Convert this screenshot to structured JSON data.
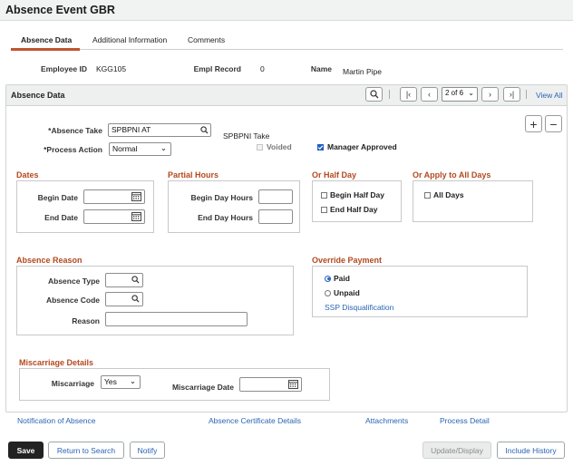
{
  "page_title": "Absence Event GBR",
  "tabs": [
    {
      "label": "Absence Data",
      "active": true
    },
    {
      "label": "Additional Information"
    },
    {
      "label": "Comments"
    }
  ],
  "employee": {
    "id_label": "Employee ID",
    "id_value": "KGG105",
    "rec_label": "Empl Record",
    "rec_value": "0",
    "name_label": "Name",
    "name_value": "Martin Pipe"
  },
  "panel": {
    "title": "Absence Data",
    "page_selector": "2 of 6",
    "view_all": "View All"
  },
  "absence": {
    "take_label": "*Absence Take",
    "take_value": "SPBPNI AT",
    "take_desc": "SPBPNI Take",
    "action_label": "*Process Action",
    "action_value": "Normal",
    "voided_label": "Voided",
    "voided_checked": false,
    "approved_label": "Manager Approved",
    "approved_checked": true
  },
  "dates": {
    "title": "Dates",
    "begin_label": "Begin Date",
    "end_label": "End Date"
  },
  "partial": {
    "title": "Partial Hours",
    "begin_label": "Begin Day Hours",
    "end_label": "End Day Hours"
  },
  "half_day": {
    "title": "Or Half Day",
    "begin_label": "Begin Half Day",
    "end_label": "End Half Day"
  },
  "all_days": {
    "title": "Or Apply to All Days",
    "label": "All Days"
  },
  "reason": {
    "title": "Absence Reason",
    "type_label": "Absence Type",
    "code_label": "Absence Code",
    "reason_label": "Reason"
  },
  "override": {
    "title": "Override Payment",
    "paid_label": "Paid",
    "unpaid_label": "Unpaid",
    "selected": "Paid",
    "ssp_link": "SSP Disqualification"
  },
  "miscarriage": {
    "title": "Miscarriage Details",
    "label": "Miscarriage",
    "value": "Yes",
    "date_label": "Miscarriage Date"
  },
  "links": [
    "Notification of Absence",
    "Absence Certificate Details",
    "Attachments",
    "Process Detail"
  ],
  "buttons": {
    "save": "Save",
    "return": "Return to Search",
    "notify": "Notify",
    "update": "Update/Display",
    "history": "Include History"
  }
}
